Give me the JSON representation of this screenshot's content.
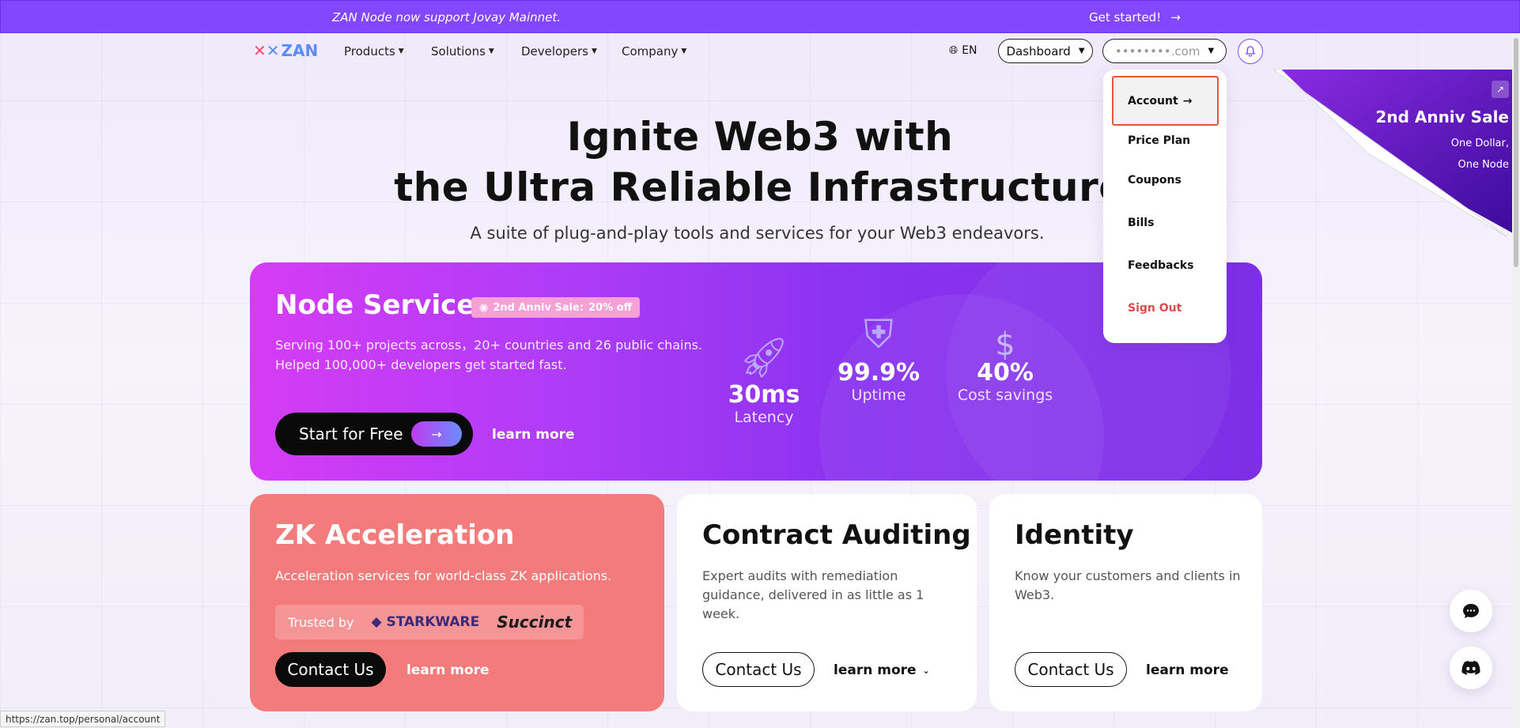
{
  "announcement": {
    "message": "ZAN Node now support Jovay Mainnet.",
    "cta": "Get started!"
  },
  "nav": {
    "logo": "ZAN",
    "items": [
      {
        "label": "Products"
      },
      {
        "label": "Solutions"
      },
      {
        "label": "Developers"
      },
      {
        "label": "Company"
      }
    ],
    "language": "EN",
    "dashboard": "Dashboard",
    "account_email": "••••••••.com"
  },
  "hero": {
    "title_line1": "Ignite Web3 with",
    "title_line2": "the Ultra Reliable Infrastructure",
    "subtitle": "A suite of plug-and-play tools and services for your Web3 endeavors."
  },
  "node_service": {
    "title": "Node Service",
    "badge_prefix": "2nd Anniv Sale:",
    "badge_value": "20% off",
    "desc_line1": "Serving 100+ projects across，20+ countries and 26 public chains.",
    "desc_line2": "Helped 100,000+ developers get started fast.",
    "start_button": "Start for Free",
    "learn_more": "learn more",
    "stats": [
      {
        "value": "30ms",
        "label": "Latency"
      },
      {
        "value": "99.9%",
        "label": "Uptime"
      },
      {
        "value": "40%",
        "label": "Cost savings"
      }
    ]
  },
  "cards": {
    "zk": {
      "title": "ZK Acceleration",
      "desc": "Acceleration services for world-class ZK applications.",
      "trusted_label": "Trusted by",
      "trusted_logos": [
        "STARKWARE",
        "Succinct"
      ],
      "contact": "Contact Us",
      "learn_more": "learn more"
    },
    "audit": {
      "title": "Contract Auditing",
      "desc": "Expert audits with remediation guidance, delivered in as little as 1 week.",
      "contact": "Contact Us",
      "learn_more": "learn more"
    },
    "identity": {
      "title": "Identity",
      "desc": "Know your customers and clients in Web3.",
      "contact": "Contact Us",
      "learn_more": "learn more"
    }
  },
  "account_menu": {
    "items": [
      {
        "label": "Account"
      },
      {
        "label": "Price Plan"
      },
      {
        "label": "Coupons"
      },
      {
        "label": "Bills"
      },
      {
        "label": "Feedbacks"
      },
      {
        "label": "Sign Out"
      }
    ]
  },
  "anniv_banner": {
    "title": "2nd Anniv Sale",
    "line1": "One Dollar,",
    "line2": "One Node"
  },
  "status_url": "https://zan.top/personal/account",
  "colors": {
    "brand_purple": "#8247ff",
    "zk_coral": "#f47b7b",
    "signout_red": "#e04b4b",
    "highlight_border": "#e05a3a"
  }
}
